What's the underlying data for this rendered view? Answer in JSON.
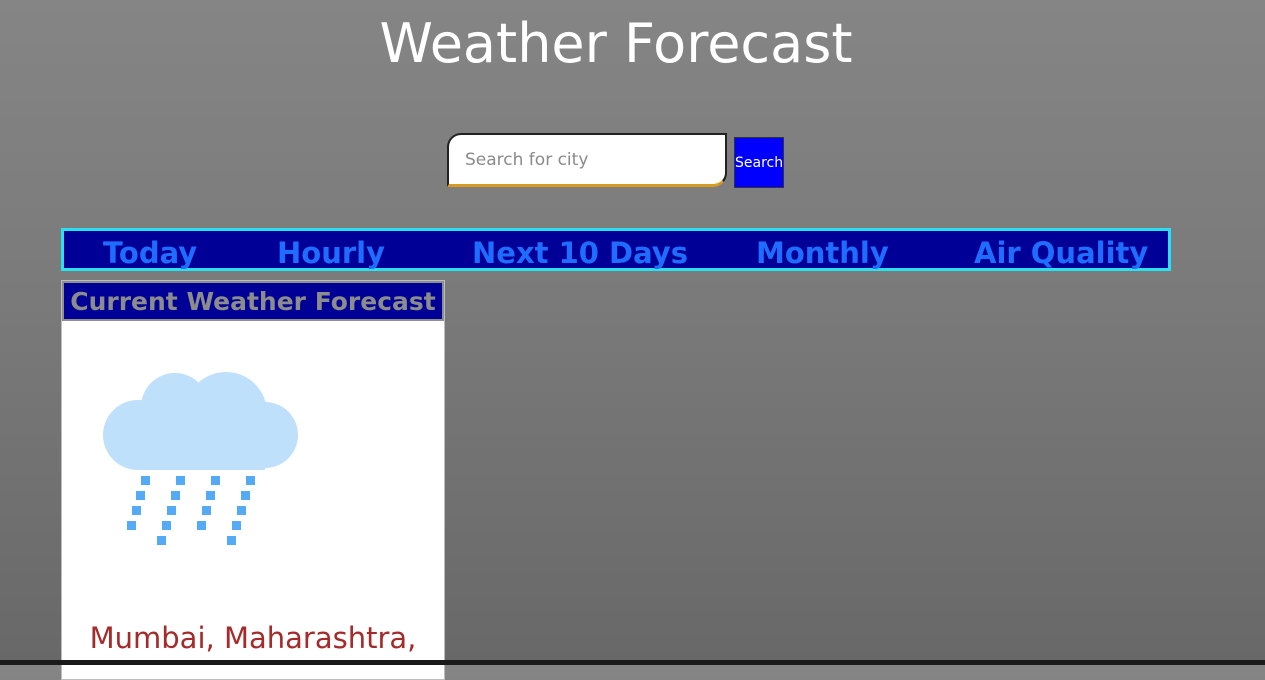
{
  "header": {
    "title": "Weather Forecast"
  },
  "search": {
    "placeholder": "Search for city",
    "value": "",
    "button_label": "Search"
  },
  "nav": {
    "items": [
      {
        "label": "Today"
      },
      {
        "label": "Hourly"
      },
      {
        "label": "Next 10 Days"
      },
      {
        "label": "Monthly"
      },
      {
        "label": "Air Quality"
      }
    ]
  },
  "current_card": {
    "title": "Current Weather Forecast",
    "icon": "rain-cloud-icon",
    "location": "Mumbai, Maharashtra,"
  },
  "colors": {
    "nav_background": "#000096",
    "nav_border": "#28e0f0",
    "nav_link": "#1f6dff",
    "search_button": "#0000ff",
    "location_text": "#a52a2a",
    "cloud": "#bfe0fa",
    "rain": "#55aaf5"
  }
}
